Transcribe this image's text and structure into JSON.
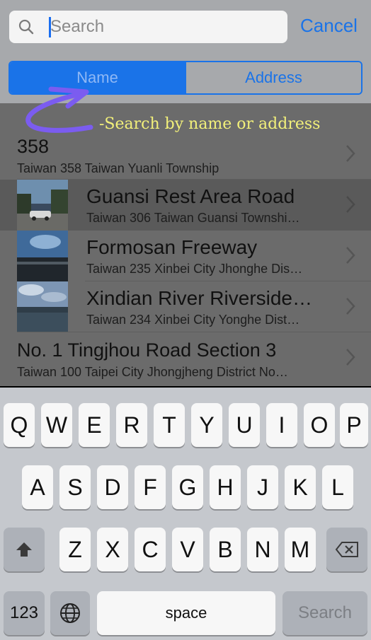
{
  "search": {
    "placeholder": "Search",
    "value": "",
    "cancel_label": "Cancel"
  },
  "segments": [
    {
      "label": "Name",
      "selected": true
    },
    {
      "label": "Address",
      "selected": false
    }
  ],
  "annotation": "-Search by name or address",
  "results": [
    {
      "title": "358",
      "subtitle": "Taiwan 358 Taiwan Yuanli Township",
      "thumbnail": false
    },
    {
      "title": "Guansi Rest Area Road",
      "subtitle": "Taiwan 306 Taiwan Guansi Townshi…",
      "thumbnail": true
    },
    {
      "title": "Formosan Freeway",
      "subtitle": "Taiwan 235 Xinbei City Jhonghe Dis…",
      "thumbnail": true
    },
    {
      "title": "Xindian River Riverside…",
      "subtitle": "Taiwan 234 Xinbei City Yonghe Dist…",
      "thumbnail": true
    },
    {
      "title": "No. 1 Tingjhou Road Section 3",
      "subtitle": "Taiwan 100 Taipei City Jhongjheng District No…",
      "thumbnail": false
    }
  ],
  "keyboard": {
    "row1": [
      "Q",
      "W",
      "E",
      "R",
      "T",
      "Y",
      "U",
      "I",
      "O",
      "P"
    ],
    "row2": [
      "A",
      "S",
      "D",
      "F",
      "G",
      "H",
      "J",
      "K",
      "L"
    ],
    "row3": [
      "Z",
      "X",
      "C",
      "V",
      "B",
      "N",
      "M"
    ],
    "numbers_label": "123",
    "space_label": "space",
    "search_label": "Search"
  },
  "colors": {
    "accent": "#1a73e8",
    "annotation": "#f2f07a"
  }
}
